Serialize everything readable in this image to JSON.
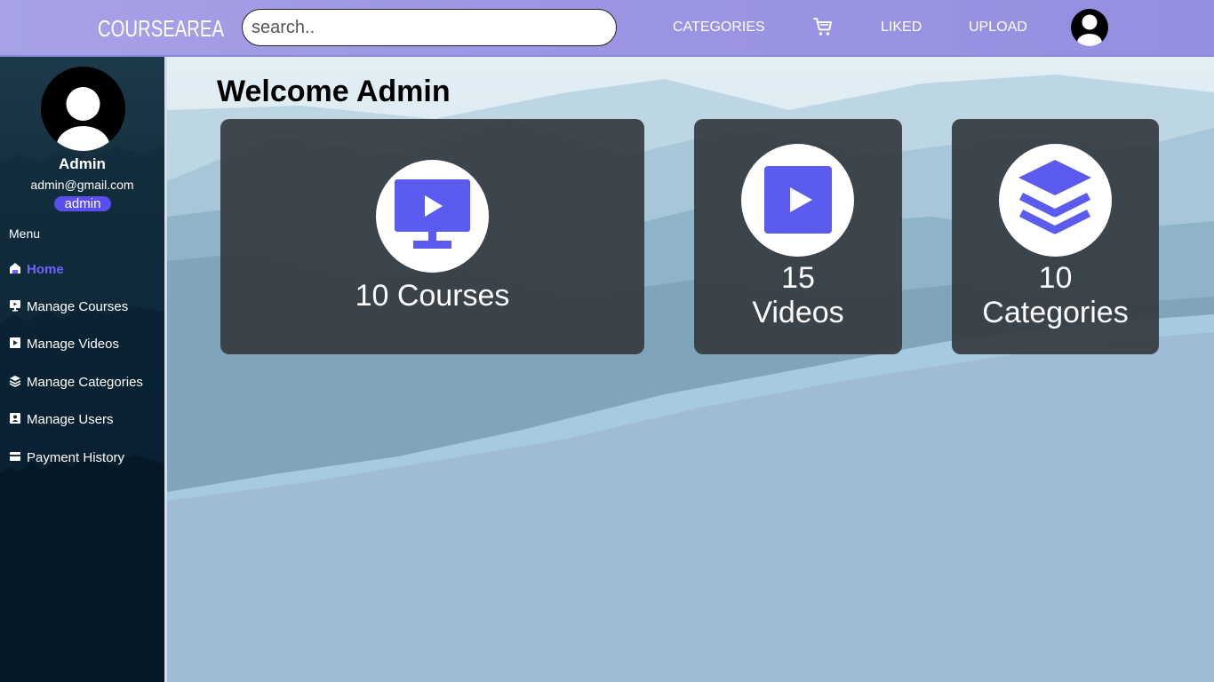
{
  "header": {
    "brand": "COURSEAREA",
    "search_placeholder": "search..",
    "nav": {
      "categories": "CATEGORIES",
      "cart_icon": "cart-icon",
      "liked": "LIKED",
      "upload": "UPLOAD",
      "avatar_icon": "user-avatar-icon"
    }
  },
  "sidebar": {
    "profile": {
      "name": "Admin",
      "email": "admin@gmail.com",
      "role": "admin"
    },
    "menu_title": "Menu",
    "items": [
      {
        "label": "Home",
        "icon": "home-icon",
        "active": true
      },
      {
        "label": "Manage Courses",
        "icon": "monitor-play-icon",
        "active": false
      },
      {
        "label": "Manage Videos",
        "icon": "video-play-icon",
        "active": false
      },
      {
        "label": "Manage Categories",
        "icon": "layers-icon",
        "active": false
      },
      {
        "label": "Manage Users",
        "icon": "user-card-icon",
        "active": false
      },
      {
        "label": "Payment History",
        "icon": "credit-card-icon",
        "active": false
      }
    ]
  },
  "main": {
    "title": "Welcome Admin",
    "cards": [
      {
        "count": "10",
        "unit": "Courses",
        "text": "10 Courses",
        "icon": "monitor-play-icon"
      },
      {
        "count": "15",
        "unit": "Videos",
        "icon": "video-play-icon"
      },
      {
        "count": "10",
        "unit": "Categories",
        "icon": "layers-icon"
      }
    ]
  },
  "colors": {
    "topbar": "#9c96e4",
    "accent": "#5b5bf0",
    "active_menu": "#6d63ff",
    "card_bg": "#343a40",
    "sidebar_bg": "#0b2232"
  }
}
